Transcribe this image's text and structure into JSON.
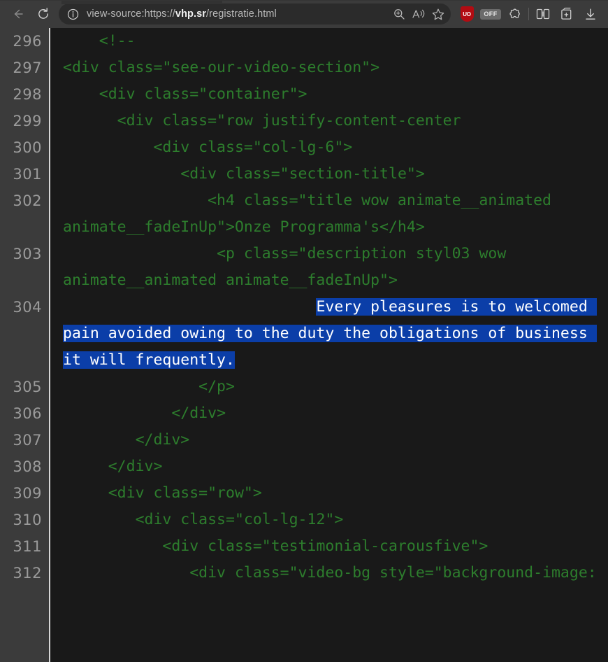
{
  "browser": {
    "back_button": "Back",
    "refresh_button": "Refresh",
    "info_icon": "site-information",
    "url_prefix": "view-source:https://",
    "url_host": "vhp.sr",
    "url_suffix": "/registratie.html",
    "url_full": "view-source:https://vhp.sr/registratie.html",
    "zoom_icon": "search-zoom",
    "read_aloud_icon": "read-aloud",
    "favorite_icon": "favorite-star",
    "shield_label": "UO",
    "toggle_label": "OFF",
    "extensions_icon": "puzzle-piece",
    "split_screen_icon": "split-screen",
    "collections_icon": "add-to-collections",
    "downloads_icon": "downloads-arrow",
    "colors": {
      "chrome_bg": "#3b3b3b",
      "omnibox_bg": "#2b2b2b",
      "shield_red": "#b20c12"
    }
  },
  "source": {
    "colors": {
      "background": "#191919",
      "gutter": "#3b3b3b",
      "code_green": "#2d7d2d",
      "line_number": "#9b9b9b",
      "selection_blue": "#0b3ea8",
      "selection_text": "#ffffff"
    },
    "selection_text": "Every pleasures is to welcomed pain avoided owing to the duty the obligations of business it will frequently.",
    "lines": [
      {
        "number": "296",
        "text": "    <!--"
      },
      {
        "number": "297",
        "text": "<div class=\"see-our-video-section\">"
      },
      {
        "number": "298",
        "text": "    <div class=\"container\">"
      },
      {
        "number": "299",
        "text": "      <div class=\"row justify-content-center"
      },
      {
        "number": "300",
        "text": "          <div class=\"col-lg-6\">"
      },
      {
        "number": "301",
        "text": "             <div class=\"section-title\">"
      },
      {
        "number": "302",
        "text": "                <h4 class=\"title wow animate__animated animate__fadeInUp\">Onze Programma's</h4>"
      },
      {
        "number": "303",
        "text": "                 <p class=\"description styl03 wow animate__animated animate__fadeInUp\">"
      },
      {
        "number": "304",
        "pre": "                            ",
        "selected": "Every pleasures is to welcomed pain avoided owing to the duty the obligations of business it will frequently."
      },
      {
        "number": "305",
        "text": "               </p>"
      },
      {
        "number": "306",
        "text": "            </div>"
      },
      {
        "number": "307",
        "text": "        </div>"
      },
      {
        "number": "308",
        "text": "     </div>"
      },
      {
        "number": "309",
        "text": "     <div class=\"row\">"
      },
      {
        "number": "310",
        "text": "        <div class=\"col-lg-12\">"
      },
      {
        "number": "311",
        "text": "           <div class=\"testimonial-carousfive\">"
      },
      {
        "number": "312",
        "text": "              <div class=\"video-bg style=\"background-image:"
      }
    ]
  }
}
